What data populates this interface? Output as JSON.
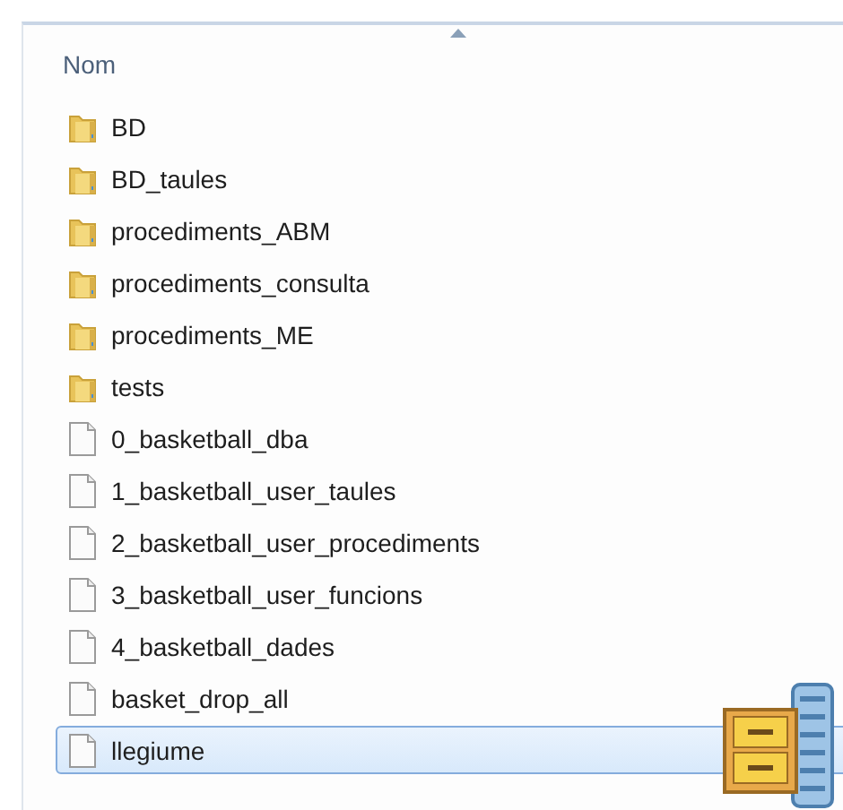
{
  "header": {
    "column": "Nom",
    "sort_ascending": true
  },
  "items": [
    {
      "name": "BD",
      "kind": "folder",
      "selected": false
    },
    {
      "name": "BD_taules",
      "kind": "folder",
      "selected": false
    },
    {
      "name": "procediments_ABM",
      "kind": "folder",
      "selected": false
    },
    {
      "name": "procediments_consulta",
      "kind": "folder",
      "selected": false
    },
    {
      "name": "procediments_ME",
      "kind": "folder",
      "selected": false
    },
    {
      "name": "tests",
      "kind": "folder",
      "selected": false
    },
    {
      "name": "0_basketball_dba",
      "kind": "file",
      "selected": false
    },
    {
      "name": "1_basketball_user_taules",
      "kind": "file",
      "selected": false
    },
    {
      "name": "2_basketball_user_procediments",
      "kind": "file",
      "selected": false
    },
    {
      "name": "3_basketball_user_funcions",
      "kind": "file",
      "selected": false
    },
    {
      "name": "4_basketball_dades",
      "kind": "file",
      "selected": false
    },
    {
      "name": "basket_drop_all",
      "kind": "file",
      "selected": false
    },
    {
      "name": "llegiume",
      "kind": "file",
      "selected": true
    }
  ],
  "drag_overlay": {
    "kind": "archive"
  }
}
